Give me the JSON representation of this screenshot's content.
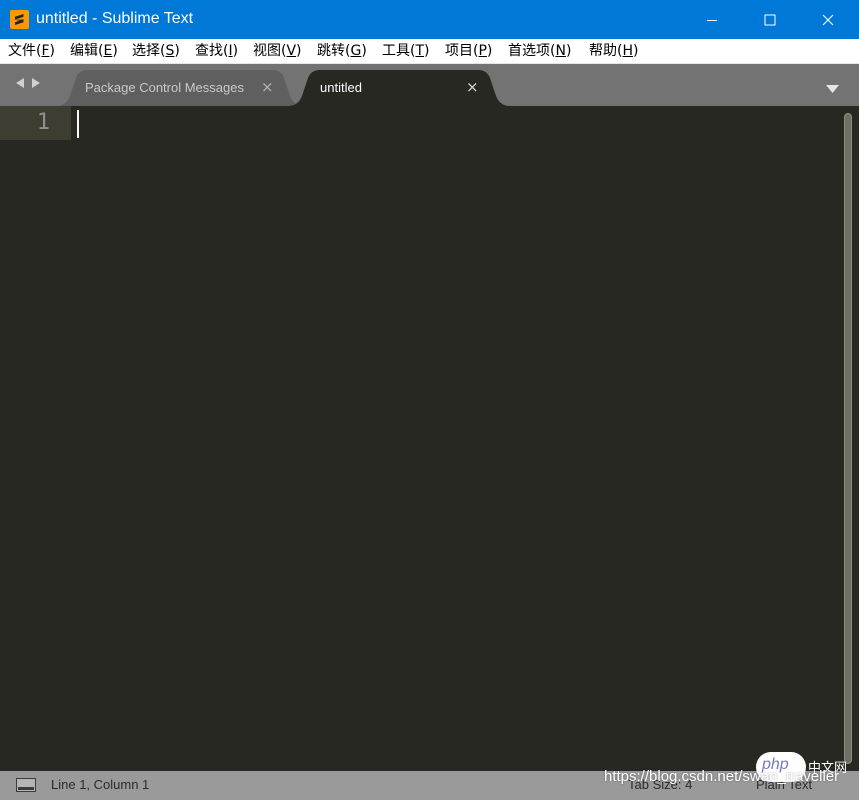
{
  "window": {
    "title": "untitled - Sublime Text",
    "app_icon": "sublime-logo",
    "controls": [
      "minimize-icon",
      "maximize-icon",
      "close-icon"
    ]
  },
  "menu": [
    {
      "prefix": "文件(",
      "key": "F",
      "suffix": ")"
    },
    {
      "prefix": "编辑(",
      "key": "E",
      "suffix": ")"
    },
    {
      "prefix": "选择(",
      "key": "S",
      "suffix": ")"
    },
    {
      "prefix": "查找(",
      "key": "I",
      "suffix": ")"
    },
    {
      "prefix": "视图(",
      "key": "V",
      "suffix": ")"
    },
    {
      "prefix": "跳转(",
      "key": "G",
      "suffix": ")"
    },
    {
      "prefix": "工具(",
      "key": "T",
      "suffix": ")"
    },
    {
      "prefix": "项目(",
      "key": "P",
      "suffix": ")"
    },
    {
      "prefix": "首选项(",
      "key": "N",
      "suffix": ")"
    },
    {
      "prefix": "帮助(",
      "key": "H",
      "suffix": ")"
    }
  ],
  "tabs": [
    {
      "label": "Package Control Messages",
      "close": "×",
      "active": false
    },
    {
      "label": "untitled",
      "close": "×",
      "active": true
    }
  ],
  "editor": {
    "line_numbers": [
      "1"
    ],
    "background": "#272822"
  },
  "status": {
    "position": "Line 1, Column 1",
    "tab_size": "Tab Size: 4",
    "syntax": "Plain Text"
  },
  "watermark": {
    "url": "https://blog.csdn.net/swan_traveller",
    "badge": "php",
    "cn": "中文网"
  },
  "colors": {
    "titlebar": "#0078d7",
    "editor_bg": "#272822",
    "tabbar_bg": "#737373",
    "statusbar_bg": "#9a9a9a"
  }
}
